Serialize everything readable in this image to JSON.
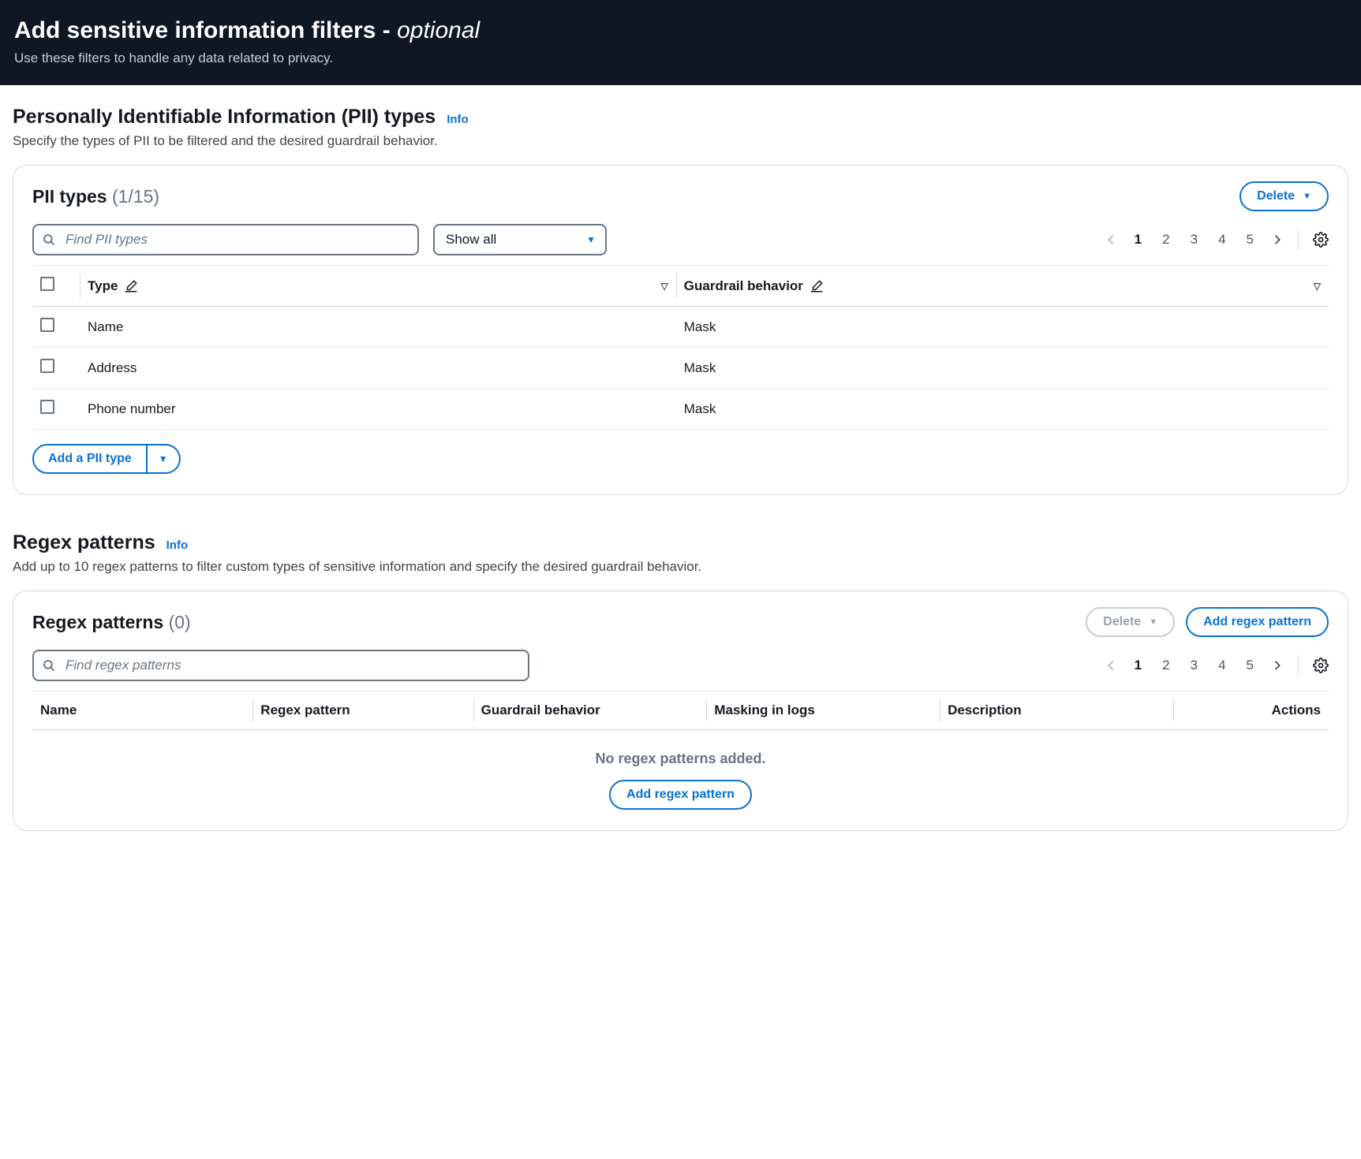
{
  "header": {
    "title_main": "Add sensitive information filters - ",
    "title_optional": "optional",
    "subtitle": "Use these filters to handle any data related to privacy."
  },
  "pii_section": {
    "heading": "Personally Identifiable Information (PII) types",
    "info_label": "Info",
    "sub": "Specify the types of PII to be filtered and the desired guardrail behavior.",
    "card_title": "PII types",
    "count_text": "(1/15)",
    "delete_label": "Delete",
    "search_placeholder": "Find PII types",
    "filter_select": "Show all",
    "pages": [
      "1",
      "2",
      "3",
      "4",
      "5"
    ],
    "col_type": "Type",
    "col_behavior": "Guardrail behavior",
    "rows": [
      {
        "type": "Name",
        "behavior": "Mask"
      },
      {
        "type": "Address",
        "behavior": "Mask"
      },
      {
        "type": "Phone number",
        "behavior": "Mask"
      }
    ],
    "add_label": "Add a PII type"
  },
  "regex_section": {
    "heading": "Regex patterns",
    "info_label": "Info",
    "sub": "Add up to 10 regex patterns to filter custom types of sensitive information and specify the desired guardrail behavior.",
    "card_title": "Regex patterns",
    "count_text": "(0)",
    "delete_label": "Delete",
    "add_label": "Add regex pattern",
    "search_placeholder": "Find regex patterns",
    "pages": [
      "1",
      "2",
      "3",
      "4",
      "5"
    ],
    "cols": {
      "name": "Name",
      "pattern": "Regex pattern",
      "behavior": "Guardrail behavior",
      "logs": "Masking in logs",
      "desc": "Description",
      "actions": "Actions"
    },
    "empty_msg": "No regex patterns added.",
    "empty_add_label": "Add regex pattern"
  }
}
